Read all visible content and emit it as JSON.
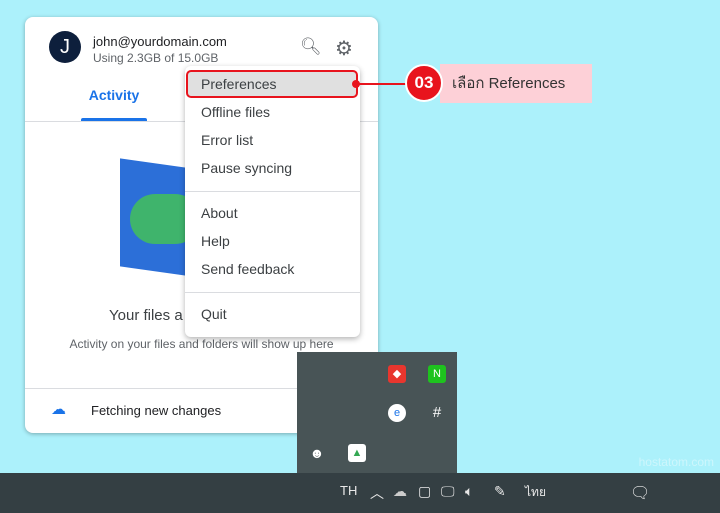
{
  "account": {
    "initial": "J",
    "email": "john@yourdomain.com",
    "usage": "Using 2.3GB of 15.0GB"
  },
  "header_icons": [
    "search-icon",
    "gear-icon"
  ],
  "tabs": [
    {
      "label": "Activity",
      "active": true
    }
  ],
  "main": {
    "title": "Your files a",
    "subtitle": "Activity on your files and folders will show up here",
    "status": "Fetching new changes"
  },
  "menu": {
    "items": [
      "Preferences",
      "Offline files",
      "Error list",
      "Pause syncing",
      "About",
      "Help",
      "Send feedback",
      "Quit"
    ],
    "selected": "Preferences"
  },
  "callout": {
    "step": "03",
    "text": "เลือก References"
  },
  "taskbar": {
    "language": "TH",
    "ime": "ไทย"
  },
  "watermark": "hostatom.com",
  "colors": {
    "accent": "#1a73e8",
    "highlight": "#e8141d",
    "callout_bg": "#fdd0d7"
  }
}
